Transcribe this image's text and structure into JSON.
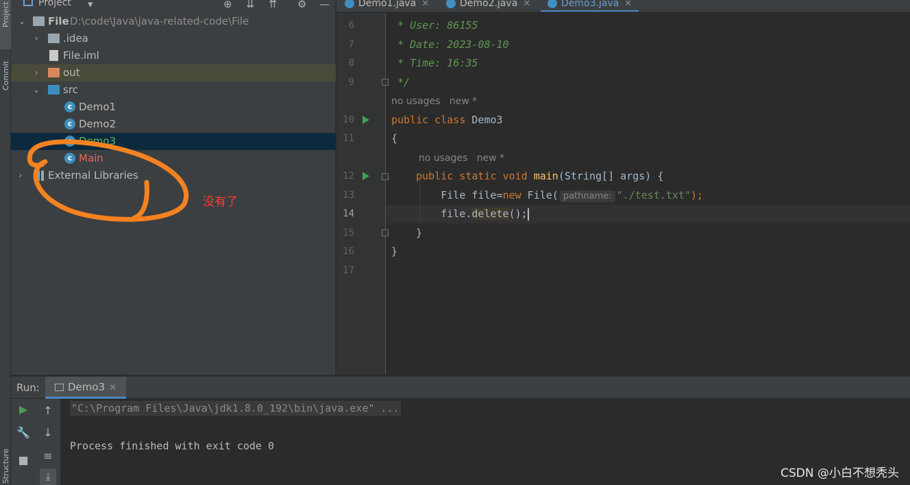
{
  "tool_strip": {
    "project_tab": "Project",
    "commit_tab": "Commit",
    "structure_tab": "Structure"
  },
  "project_panel": {
    "title": "Project",
    "tree": [
      {
        "label": "File",
        "path": "D:\\code\\Java\\java-related-code\\File",
        "icon": "module-folder-icon",
        "expanded": true
      },
      {
        "label": ".idea",
        "icon": "folder-icon",
        "expanded": false
      },
      {
        "label": "File.iml",
        "icon": "iml-file-icon"
      },
      {
        "label": "out",
        "icon": "excluded-folder-icon",
        "expanded": false
      },
      {
        "label": "src",
        "icon": "source-folder-icon",
        "expanded": true
      },
      {
        "label": "Demo1",
        "icon": "java-class-icon"
      },
      {
        "label": "Demo2",
        "icon": "java-class-icon"
      },
      {
        "label": "Demo3",
        "icon": "java-class-icon",
        "selected": true
      },
      {
        "label": "Main",
        "icon": "java-class-icon",
        "status": "deleted"
      },
      {
        "label": "External Libraries",
        "icon": "library-icon",
        "expanded": false
      }
    ]
  },
  "editor": {
    "tabs": [
      {
        "label": "Demo1.java",
        "active": false
      },
      {
        "label": "Demo2.java",
        "active": false
      },
      {
        "label": "Demo3.java",
        "active": true
      }
    ],
    "lines": {
      "l6": {
        "num": "6",
        "text": " * User: 86155"
      },
      "l7": {
        "num": "7",
        "text": " * Date: 2023-08-10"
      },
      "l8": {
        "num": "8",
        "text": " * Time: 16:35"
      },
      "l9": {
        "num": "9",
        "text": " */"
      },
      "l10": {
        "num": "10"
      },
      "l11": {
        "num": "11",
        "text": "{"
      },
      "l12": {
        "num": "12"
      },
      "l13": {
        "num": "13"
      },
      "l14": {
        "num": "14"
      },
      "l15": {
        "num": "15",
        "text": "    }"
      },
      "l16": {
        "num": "16",
        "text": "}"
      },
      "l17": {
        "num": "17"
      }
    },
    "hint_usages": "no usages",
    "hint_new": "new *",
    "code": {
      "kw_public": "public",
      "kw_class": "class",
      "class_name": "Demo3",
      "kw_static": "static",
      "kw_void": "void",
      "method_main": "main",
      "main_params": "(String[] args) {",
      "file_decl": "File file=",
      "kw_new": "new",
      "file_ctor": " File(",
      "inlay_param": "pathname:",
      "str_path": "\"./test.txt\"",
      "end_paren": ");",
      "file_var": "file.",
      "method_delete": "delete",
      "delete_tail": "();"
    }
  },
  "run_panel": {
    "label": "Run:",
    "tab": "Demo3",
    "console": [
      "\"C:\\Program Files\\Java\\jdk1.8.0_192\\bin\\java.exe\" ...",
      "",
      "Process finished with exit code 0"
    ]
  },
  "annotation": {
    "text": "没有了",
    "color": "#ff3b30",
    "circle_color": "#f58220"
  },
  "watermark": "CSDN @小白不想秃头",
  "colors": {
    "keyword": "#cc7832",
    "comment": "#629755",
    "string": "#6a8759",
    "method": "#ffc66d",
    "selection": "#0d293e",
    "deleted_file": "#e06c59",
    "selected_file": "#5fb35f",
    "active_tab": "#6a9fd6"
  }
}
